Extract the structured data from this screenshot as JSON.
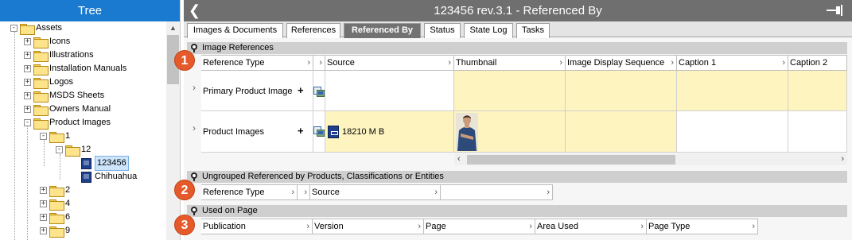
{
  "tree": {
    "title": "Tree",
    "items": [
      {
        "label": "Assets",
        "expander": "-"
      },
      {
        "label": "Icons",
        "expander": "+"
      },
      {
        "label": "Illustrations",
        "expander": "+"
      },
      {
        "label": "Installation Manuals",
        "expander": "+"
      },
      {
        "label": "Logos",
        "expander": "+"
      },
      {
        "label": "MSDS Sheets",
        "expander": "+"
      },
      {
        "label": "Owners Manual",
        "expander": "+"
      },
      {
        "label": "Product Images",
        "expander": "-"
      },
      {
        "label": "1",
        "expander": "-"
      },
      {
        "label": "12",
        "expander": "-"
      },
      {
        "label": "123456",
        "selected": true
      },
      {
        "label": "Chihuahua"
      },
      {
        "label": "2",
        "expander": "+"
      },
      {
        "label": "4",
        "expander": "+"
      },
      {
        "label": "6",
        "expander": "+"
      },
      {
        "label": "9",
        "expander": "+"
      }
    ]
  },
  "main": {
    "title": "123456 rev.3.1 - Referenced By",
    "tabs": [
      {
        "label": "Images & Documents"
      },
      {
        "label": "References"
      },
      {
        "label": "Referenced By",
        "active": true
      },
      {
        "label": "Status"
      },
      {
        "label": "State Log"
      },
      {
        "label": "Tasks"
      }
    ],
    "image_references": {
      "title": "Image References",
      "badge": "1",
      "columns": [
        "Reference Type",
        "Source",
        "Thumbnail",
        "Image Display Sequence",
        "Caption 1",
        "Caption 2"
      ],
      "rows": [
        {
          "reference_type": "Primary Product Image",
          "source": ""
        },
        {
          "reference_type": "Product Images",
          "source": "18210 M B"
        }
      ]
    },
    "ungrouped": {
      "title": "Ungrouped Referenced by Products, Classifications or Entities",
      "badge": "2",
      "columns": [
        "Reference Type",
        "Source",
        ""
      ]
    },
    "used_on_page": {
      "title": "Used on Page",
      "badge": "3",
      "columns": [
        "Publication",
        "Version",
        "Page",
        "Area Used",
        "Page Type"
      ]
    }
  },
  "colors": {
    "tree_header": "#1a7ad0",
    "title_bar": "#6f6f6f",
    "active_tab": "#727272",
    "badge": "#e55a2b",
    "yellow_cell": "#fdf4c0"
  },
  "icons": [
    "back-arrow-icon",
    "pin-icon",
    "folder-icon",
    "asset-icon",
    "link-icon",
    "plus-icon",
    "chevron-right-icon"
  ]
}
